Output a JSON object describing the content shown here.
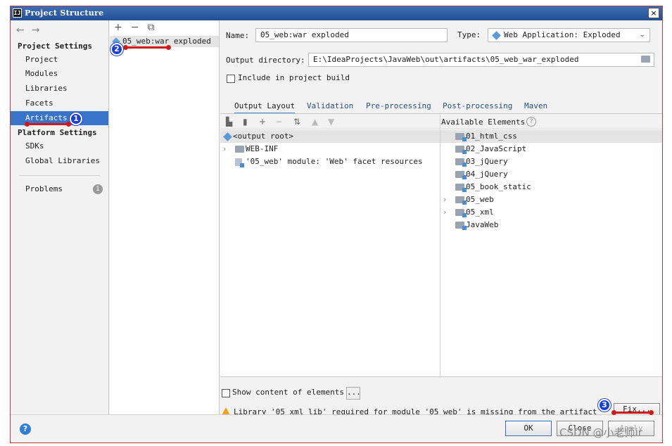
{
  "window": {
    "title": "Project Structure",
    "logo": "IJ",
    "close": "×"
  },
  "nav": {
    "back": "←",
    "forward": "→",
    "project_settings_heading": "Project Settings",
    "project_items": [
      "Project",
      "Modules",
      "Libraries",
      "Facets",
      "Artifacts"
    ],
    "platform_settings_heading": "Platform Settings",
    "platform_items": [
      "SDKs",
      "Global Libraries"
    ],
    "problems_label": "Problems",
    "problems_count": "1",
    "selected": "Artifacts"
  },
  "artifacts_list": {
    "toolbar": [
      "+",
      "−",
      "⧉"
    ],
    "items": [
      "05_web:war exploded"
    ]
  },
  "form": {
    "name_label": "Name:",
    "name_value": "05_web:war exploded",
    "type_label": "Type:",
    "type_value": "Web Application: Exploded",
    "output_label": "Output directory:",
    "output_value": "E:\\IdeaProjects\\JavaWeb\\out\\artifacts\\05_web_war_exploded",
    "include_build_label": "Include in project build"
  },
  "tabs": [
    "Output Layout",
    "Validation",
    "Pre-processing",
    "Post-processing",
    "Maven"
  ],
  "layout_tree": {
    "root": "<output root>",
    "items": [
      "WEB-INF",
      "'05_web' module: 'Web' facet resources"
    ]
  },
  "available": {
    "title": "Available Elements",
    "help": "?",
    "items": [
      "01_html_css",
      "02_JavaScript",
      "03_jQuery",
      "04_jQuery",
      "05_book_static",
      "05_web",
      "05_xml",
      "JavaWeb"
    ]
  },
  "bottom": {
    "show_content_label": "Show content of elements",
    "more_label": "...",
    "warning_text": "Library '05_xml_lib' required for module '05_web' is missing from the artifact",
    "fix_label": "Fix..."
  },
  "footer": {
    "help": "?",
    "ok_label": "OK",
    "close_label": "Close",
    "apply_label": "Apply"
  },
  "markers": [
    "1",
    "2",
    "3"
  ],
  "watermark": "CSDN @小老师ir",
  "colors": {
    "selection": "#3874c9",
    "annotation_red": "#d01818",
    "marker_blue": "#1a3fd6",
    "warning": "#f0a020"
  }
}
